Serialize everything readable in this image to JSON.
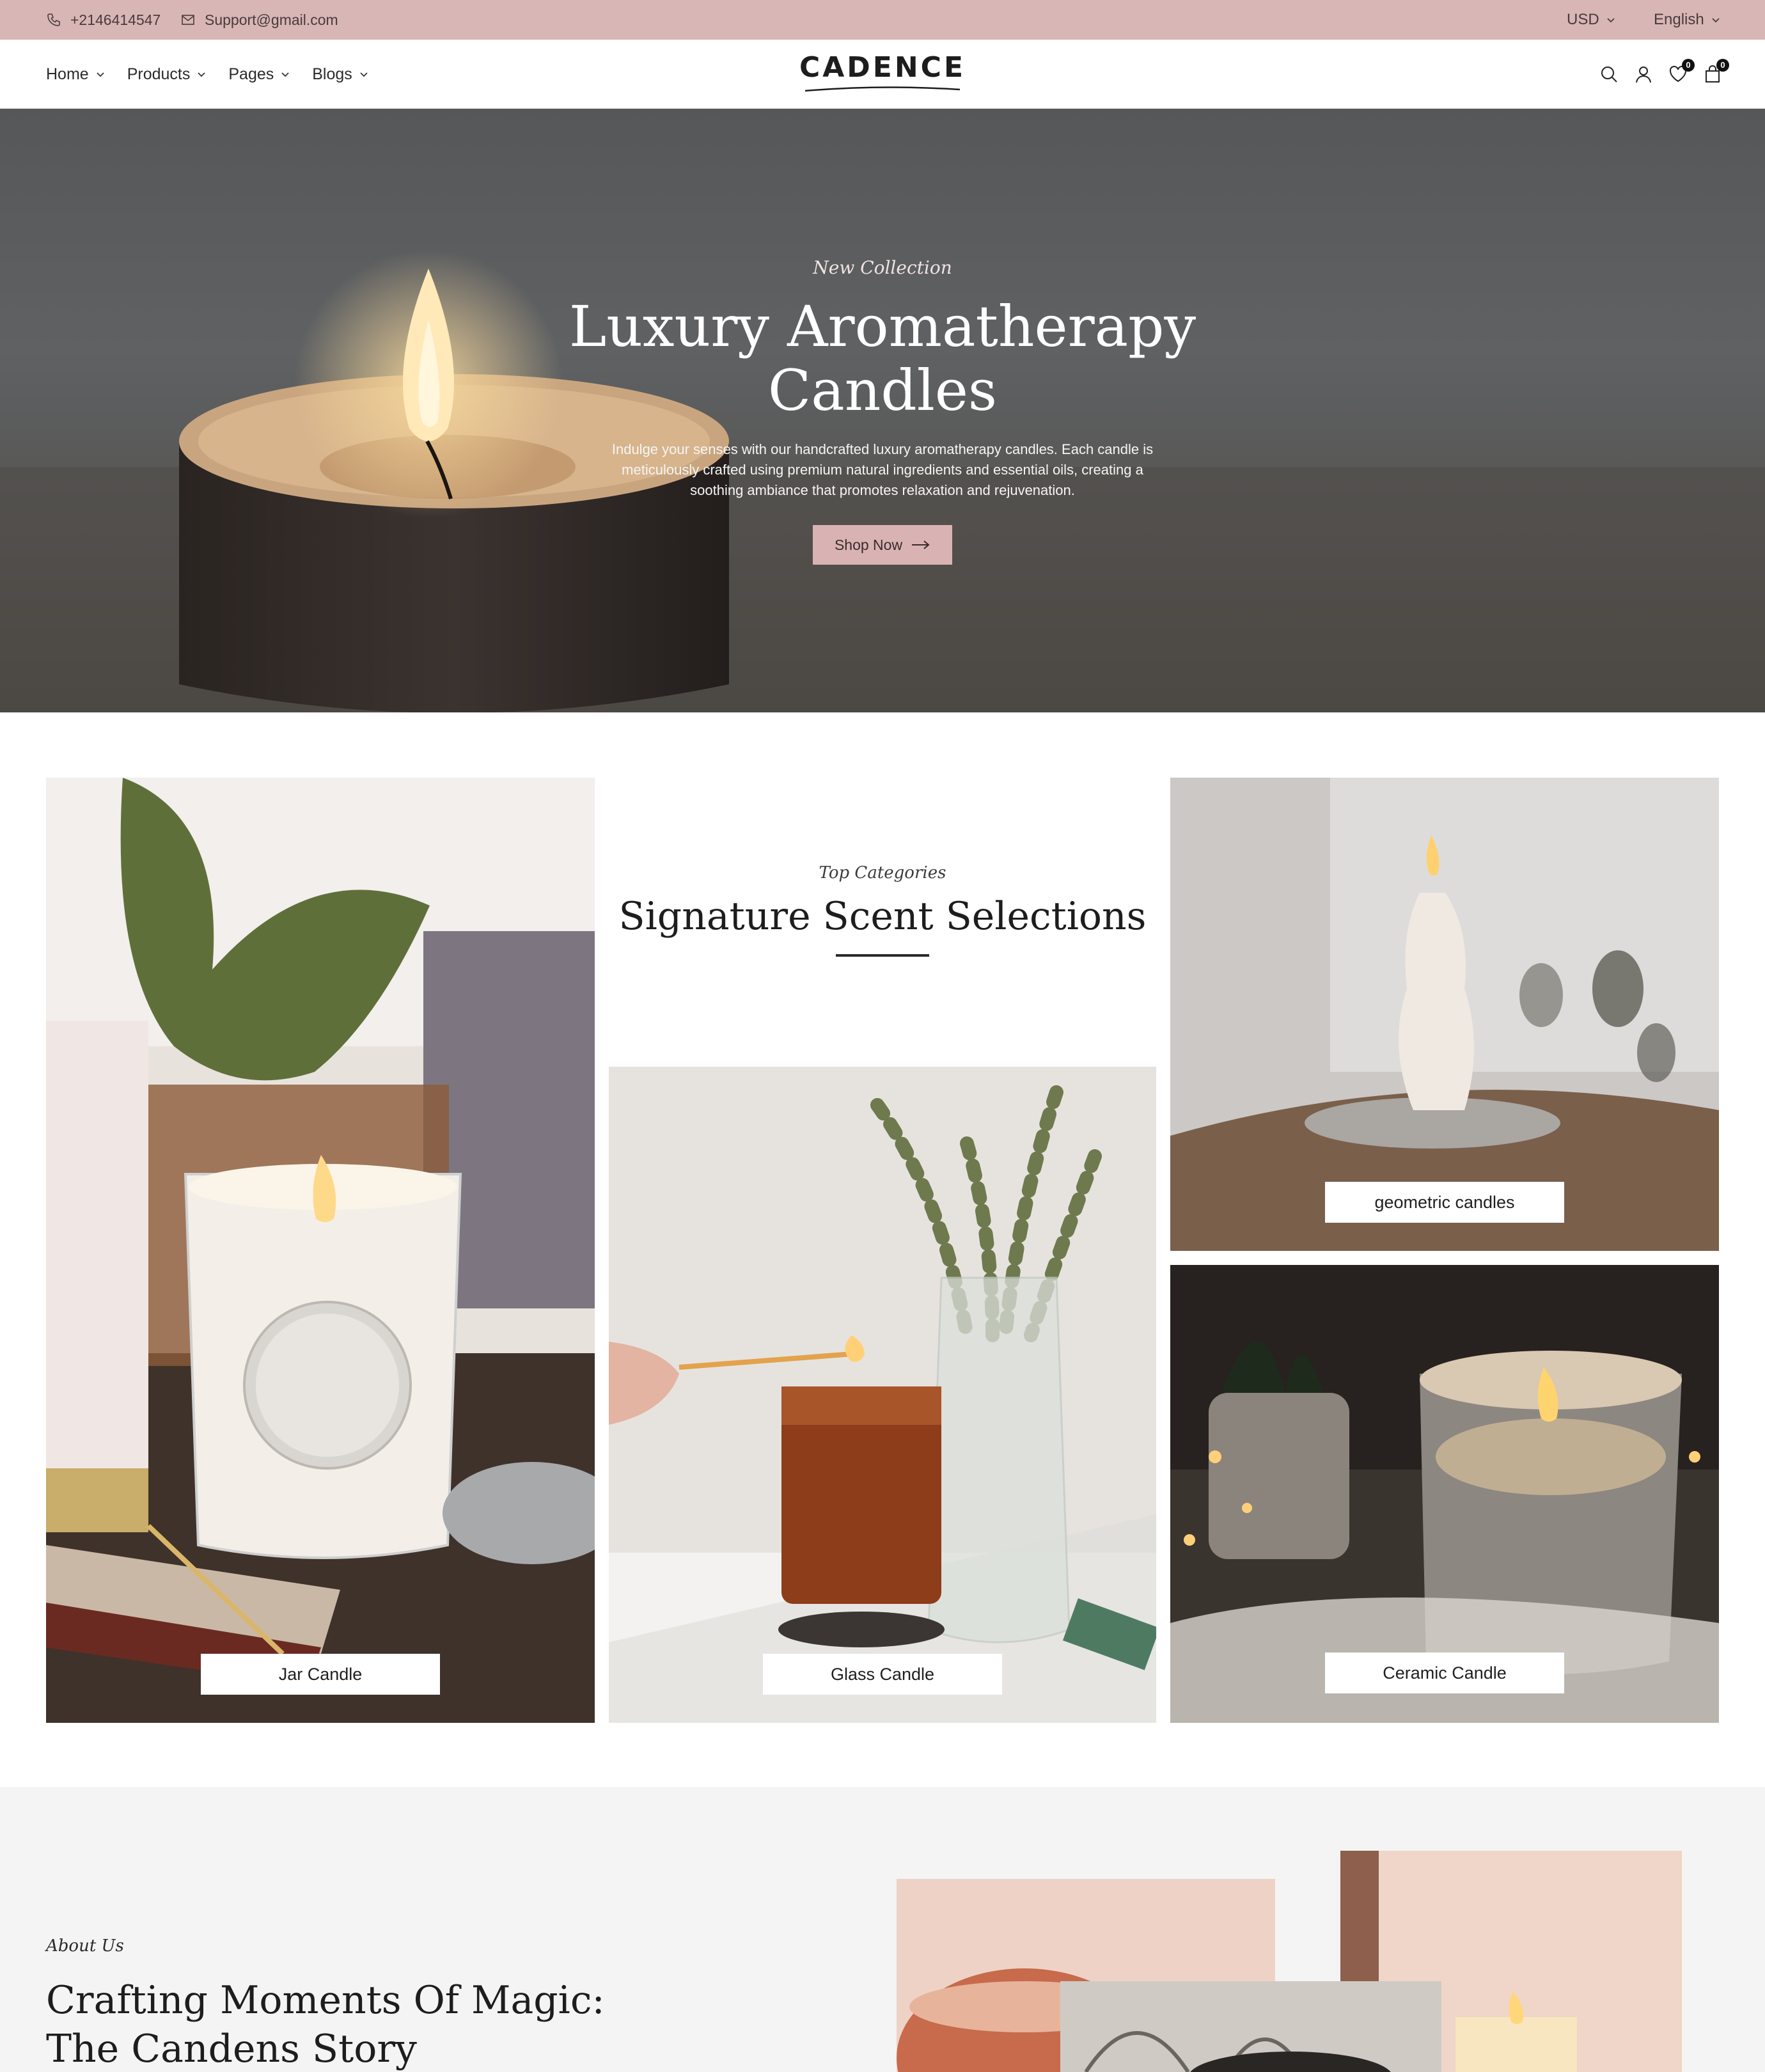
{
  "topbar": {
    "phone": "+2146414547",
    "email": "Support@gmail.com",
    "currency": "USD",
    "language": "English"
  },
  "header": {
    "logo": "CADENCE",
    "nav": [
      "Home",
      "Products",
      "Pages",
      "Blogs"
    ],
    "icons": [
      "search-icon",
      "user-icon",
      "wishlist-icon",
      "cart-icon"
    ],
    "wishlist_count": "0",
    "cart_count": "0"
  },
  "hero": {
    "subtitle": "New Collection",
    "title_line1": "Luxury Aromatherapy",
    "title_line2": "Candles",
    "description": "Indulge your senses with our handcrafted luxury aromatherapy candles. Each candle is meticulously crafted using premium natural ingredients and essential oils, creating a soothing ambiance that promotes relaxation and rejuvenation.",
    "button": "Shop Now"
  },
  "categories": {
    "subtitle": "Top Categories",
    "title": "Signature Scent Selections",
    "items": [
      "Jar Candle",
      "Glass Candle",
      "geometric candles",
      "Ceramic Candle"
    ]
  },
  "about": {
    "subtitle": "About Us",
    "title": "Crafting Moments Of Magic: The Candens Story"
  },
  "colors": {
    "topbar_bg": "#d8b6b6",
    "accent": "#d9b3b3",
    "about_bg": "#f4f4f4"
  }
}
